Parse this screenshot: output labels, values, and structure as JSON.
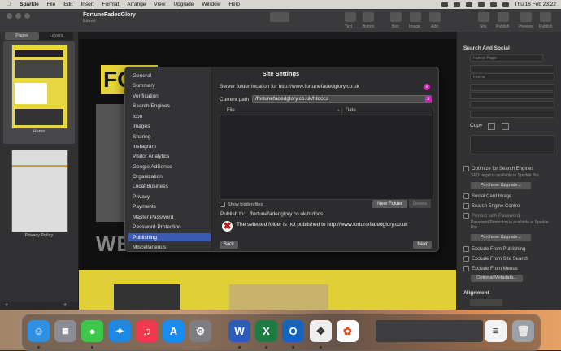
{
  "menubar": {
    "apple": "",
    "items": [
      "Sparkle",
      "File",
      "Edit",
      "Insert",
      "Format",
      "Arrange",
      "View",
      "Upgrade",
      "Window",
      "Help"
    ],
    "clock": "Thu 16 Feb  23:22"
  },
  "window": {
    "title": "FortuneFadedGlory",
    "subtitle": "Edited",
    "toolbar_labels": [
      "Pages",
      "Text",
      "Button",
      "Box",
      "Image",
      "Add",
      "Site",
      "Publish",
      "Preview",
      "Publish"
    ]
  },
  "left_panel": {
    "tabs": [
      "Pages",
      "Layers"
    ],
    "pages": [
      {
        "label": "Home"
      },
      {
        "label": "Privacy Policy"
      }
    ]
  },
  "canvas": {
    "hero_text": "FO",
    "welcome_text": "WELCOME"
  },
  "inspector": {
    "section_title": "Search And Social",
    "page_select": "Home Page",
    "field_page_title": "Home",
    "checks": [
      "Optimize for Search Engines",
      "Social Card Image",
      "Search Engine Control",
      "Protect with Password",
      "Exclude From Publishing",
      "Exclude From Site Search",
      "Exclude From Menus"
    ],
    "seo_pro_note": "SEO target is available in Sparkle Pro",
    "purchase_upgrade": "Purchase Upgrade...",
    "password_note": "Password Protection is available in Sparkle Pro",
    "copy_label": "Copy",
    "optional_metadata": "Optional Metadata...",
    "alignment_label": "Alignment"
  },
  "dialog": {
    "title": "Site Settings",
    "sidebar": [
      "General",
      "Summary",
      "Verification",
      "Search Engines",
      "Icon",
      "Images",
      "Sharing",
      "Instagram",
      "Visitor Analytics",
      "Google AdSense",
      "Organization",
      "Local Business",
      "Privacy",
      "Payments",
      "Master Password",
      "Password Protection",
      "Publishing",
      "Miscellaneous"
    ],
    "selected_item": "Publishing",
    "server_label": "Server folder location for http://www.fortunefadedglory.co.uk",
    "info_icon": "i",
    "current_path_label": "Current path",
    "current_path_value": "/fortunefadedglory.co.uk/htdocs",
    "col_file": "File",
    "col_date": "Date",
    "show_hidden": "Show hidden files",
    "new_folder": "New Folder",
    "delete": "Delete",
    "publish_to_label": "Publish to:",
    "publish_to_value": "/fortunefadedglory.co.uk/htdocs",
    "error_message": "The selected folder is not published to http://www.fortunefadedglory.co.uk",
    "back": "Back",
    "next": "Next"
  },
  "dock": {
    "apps": [
      "Finder",
      "Launchpad",
      "Messages",
      "Safari",
      "Music",
      "App Store",
      "System Settings",
      "Word",
      "Excel",
      "Outlook",
      "Sparkle",
      "Photos",
      "Window Preview",
      "Trash"
    ]
  },
  "colors": {
    "accent_selection": "#3a5bb4",
    "info_magenta": "#c92bb8",
    "hero_yellow": "#e6d43a",
    "error_red": "#c0201c"
  }
}
